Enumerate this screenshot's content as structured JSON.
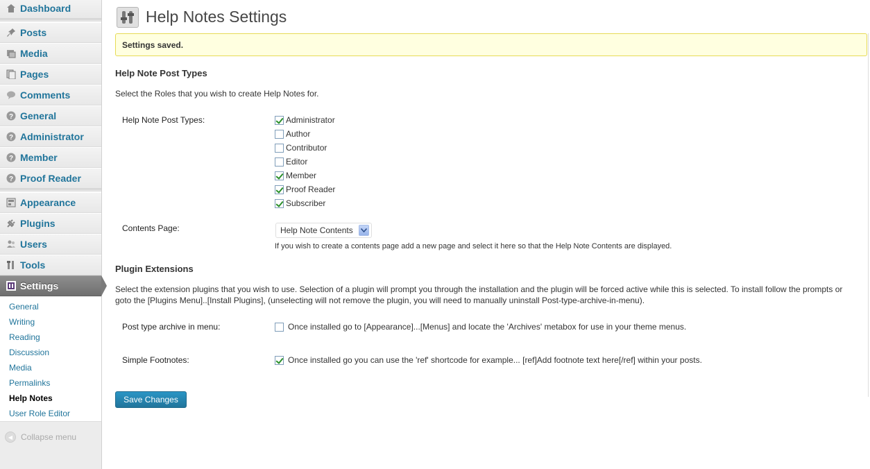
{
  "sidebar": {
    "items": [
      {
        "label": "Dashboard",
        "icon": "dashboard-icon"
      },
      {
        "label": "Posts",
        "icon": "pin-icon"
      },
      {
        "label": "Media",
        "icon": "media-icon"
      },
      {
        "label": "Pages",
        "icon": "pages-icon"
      },
      {
        "label": "Comments",
        "icon": "comment-bubble-icon"
      },
      {
        "label": "General",
        "icon": "help-circle-icon"
      },
      {
        "label": "Administrator",
        "icon": "help-circle-icon"
      },
      {
        "label": "Member",
        "icon": "help-circle-icon"
      },
      {
        "label": "Proof Reader",
        "icon": "help-circle-icon"
      },
      {
        "label": "Appearance",
        "icon": "appearance-icon"
      },
      {
        "label": "Plugins",
        "icon": "plug-icon"
      },
      {
        "label": "Users",
        "icon": "users-icon"
      },
      {
        "label": "Tools",
        "icon": "tools-icon"
      },
      {
        "label": "Settings",
        "icon": "settings-icon"
      }
    ],
    "submenu": [
      "General",
      "Writing",
      "Reading",
      "Discussion",
      "Media",
      "Permalinks",
      "Help Notes",
      "User Role Editor"
    ],
    "collapse_label": "Collapse menu"
  },
  "main": {
    "title": "Help Notes Settings",
    "notice": "Settings saved.",
    "section1": {
      "heading": "Help Note Post Types",
      "description": "Select the Roles that you wish to create Help Notes for.",
      "post_types_label": "Help Note Post Types:",
      "roles": [
        {
          "label": "Administrator",
          "checked": true
        },
        {
          "label": "Author",
          "checked": false
        },
        {
          "label": "Contributor",
          "checked": false
        },
        {
          "label": "Editor",
          "checked": false
        },
        {
          "label": "Member",
          "checked": true
        },
        {
          "label": "Proof Reader",
          "checked": true
        },
        {
          "label": "Subscriber",
          "checked": true
        }
      ],
      "contents_label": "Contents Page:",
      "contents_value": "Help Note Contents",
      "contents_help": "If you wish to create a contents page add a new page and select it here so that the Help Note Contents are displayed."
    },
    "section2": {
      "heading": "Plugin Extensions",
      "description_line1": "Select the extension plugins that you wish to use. Selection of a plugin will prompt you through the installation and the plugin will be forced active while this is selected. To install follow the prompts or",
      "description_line2": "goto the [Plugins Menu]..[Install Plugins], (unselecting will not remove the plugin, you will need to manually uninstall Post-type-archive-in-menu).",
      "archive_label": "Post type archive in menu:",
      "archive_text": "Once installed go to [Appearance]...[Menus] and locate the 'Archives' metabox for use in your theme menus.",
      "archive_checked": false,
      "footnotes_label": "Simple Footnotes:",
      "footnotes_text": "Once installed go you can use the 'ref' shortcode for example... [ref]Add footnote text here[/ref] within your posts.",
      "footnotes_checked": true
    },
    "save_label": "Save Changes"
  },
  "colors": {
    "link": "#21759b",
    "notice_bg": "#ffffe0",
    "notice_border": "#e6db55",
    "button": "#21759b"
  }
}
